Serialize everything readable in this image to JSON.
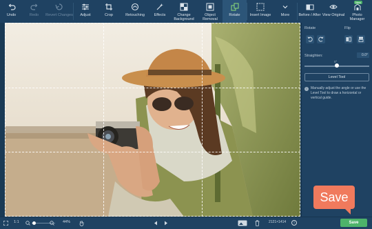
{
  "toolbar": {
    "items": [
      {
        "label": "Undo",
        "icon": "undo-icon"
      },
      {
        "label": "Redo",
        "icon": "redo-icon"
      },
      {
        "label": "Revert Changes",
        "icon": "revert-icon"
      },
      {
        "label": "Adjust",
        "icon": "sliders-icon"
      },
      {
        "label": "Crop",
        "icon": "crop-icon"
      },
      {
        "label": "Retouching",
        "icon": "retouch-icon"
      },
      {
        "label": "Effects",
        "icon": "effects-icon"
      },
      {
        "label": "Change Background",
        "icon": "background-icon"
      },
      {
        "label": "Object Removal",
        "icon": "eraser-icon"
      },
      {
        "label": "Rotate",
        "icon": "rotate-icon"
      },
      {
        "label": "Insert Image",
        "icon": "insert-image-icon"
      },
      {
        "label": "More",
        "icon": "chevron-down-icon"
      },
      {
        "label": "Before / After",
        "icon": "before-after-icon"
      },
      {
        "label": "View Original",
        "icon": "eye-icon"
      },
      {
        "label": "Photo Manager",
        "icon": "photo-manager-icon",
        "badge": "New"
      }
    ]
  },
  "panel": {
    "rotate_label": "Rotate",
    "flip_label": "Flip",
    "straighten_label": "Straighten:",
    "straighten_value": "0.0°",
    "slider_zero": "0°",
    "level_tool": "Level Tool",
    "hint": "Manually adjust the angle or use the Level Tool to draw a horizontal or vertical guide."
  },
  "bottom": {
    "ratio": "1:1",
    "zoom": "44%",
    "dimensions": "2121×1414",
    "save": "Save"
  },
  "badge": {
    "save": "Save"
  },
  "colors": {
    "accent_green": "#4db36a",
    "save_badge": "#f07a5d",
    "toolbar_bg": "#1f4262"
  }
}
